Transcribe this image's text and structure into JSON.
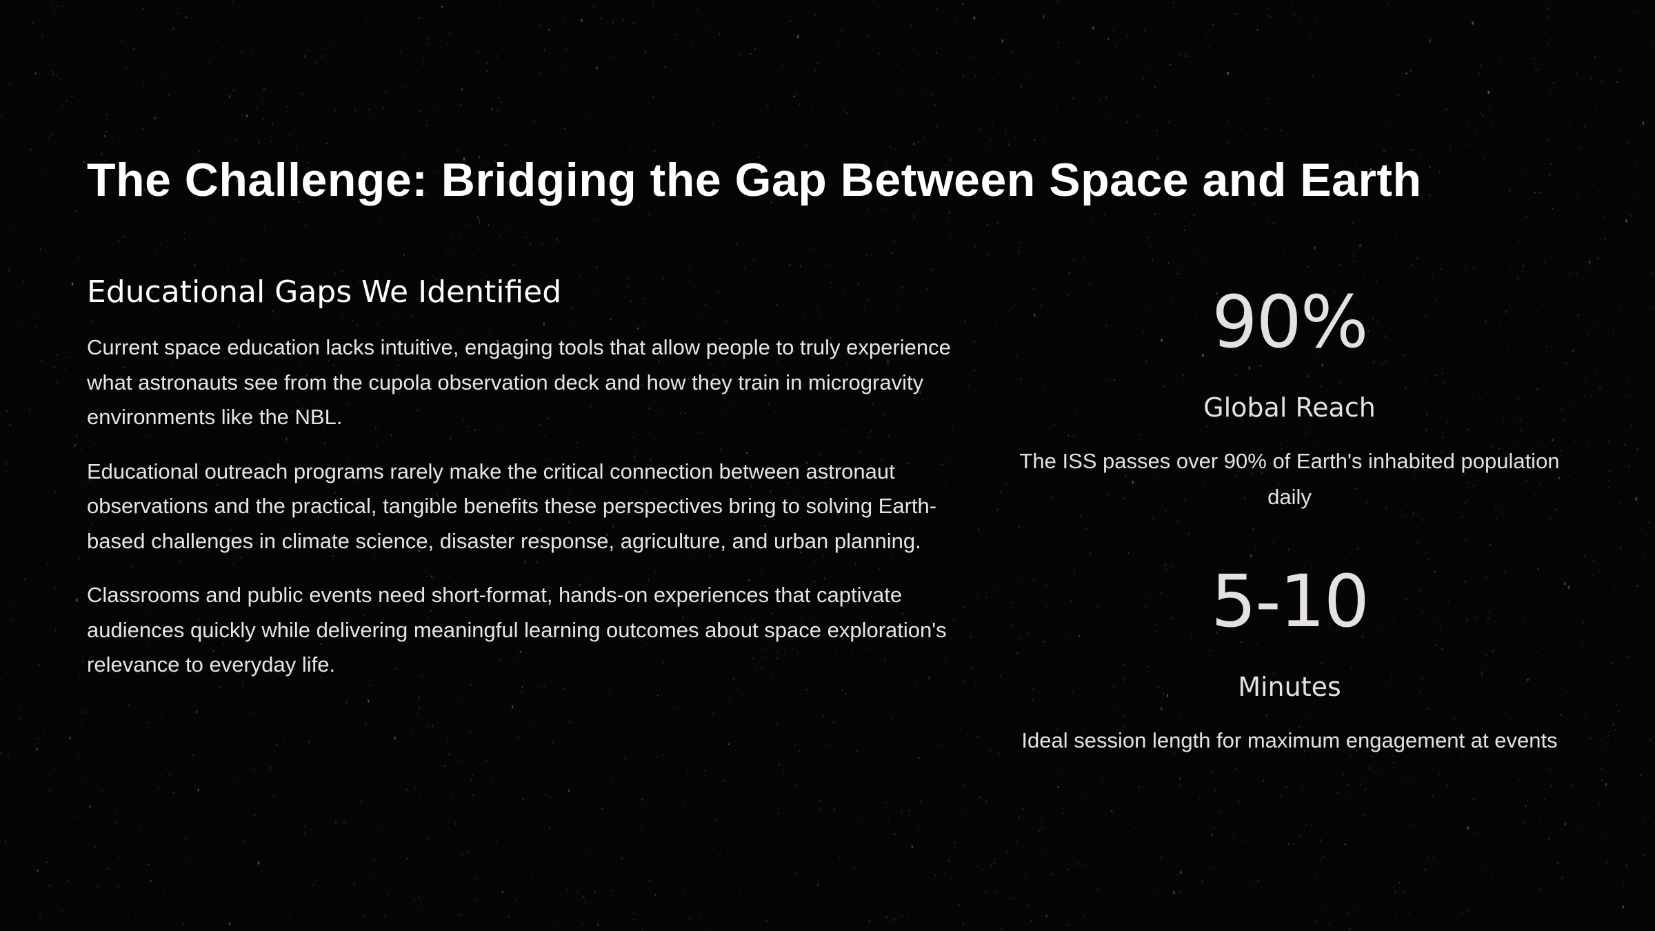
{
  "colors": {
    "background": "#050505",
    "text": "#ffffff",
    "stat_text": "#e6e1e1"
  },
  "title": "The Challenge: Bridging the Gap Between Space and Earth",
  "left": {
    "heading": "Educational Gaps We Identified",
    "paragraphs": [
      "Current space education lacks intuitive, engaging tools that allow people to truly experience what astronauts see from the cupola observation deck and how they train in microgravity environments like the NBL.",
      "Educational outreach programs rarely make the critical connection between astronaut observations and the practical, tangible benefits these perspectives bring to solving Earth-based challenges in climate science, disaster response, agriculture, and urban planning.",
      "Classrooms and public events need short-format, hands-on experiences that captivate audiences quickly while delivering meaningful learning outcomes about space exploration's relevance to everyday life."
    ]
  },
  "stats": [
    {
      "value": "90%",
      "label": "Global Reach",
      "description": "The ISS passes over 90% of Earth's inhabited population daily"
    },
    {
      "value": "5-10",
      "label": "Minutes",
      "description": "Ideal session length for maximum engagement at events"
    }
  ]
}
